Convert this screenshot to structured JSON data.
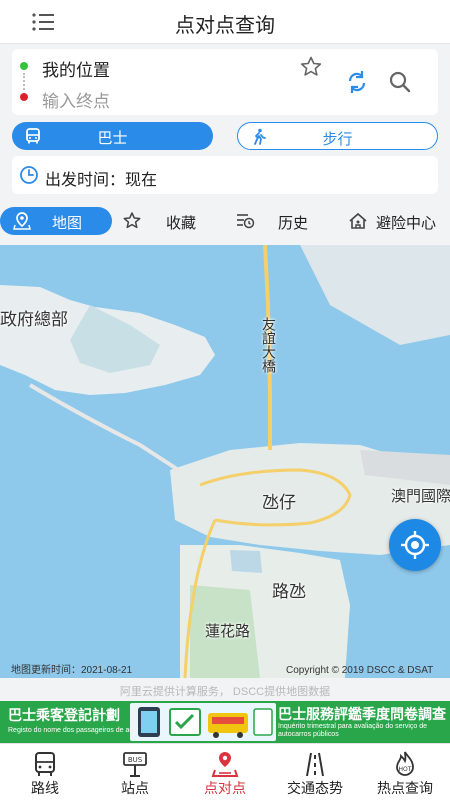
{
  "header": {
    "title": "点对点查询",
    "menu_icon": "menu-icon"
  },
  "route": {
    "from": "我的位置",
    "to_placeholder": "输入终点",
    "start_color": "#33c33c",
    "end_color": "#d9222a"
  },
  "modes": {
    "bus": "巴士",
    "walk": "步行",
    "active": "bus",
    "accent": "#2b8be8"
  },
  "departure": {
    "label": "出发时间：现在"
  },
  "tabs": [
    {
      "label": "地图",
      "icon": "map-pin-icon"
    },
    {
      "label": "收藏",
      "icon": "star-icon"
    },
    {
      "label": "历史",
      "icon": "history-icon"
    },
    {
      "label": "避险中心",
      "icon": "shelter-icon"
    }
  ],
  "map": {
    "labels": [
      "政府總部",
      "友誼大橋",
      "氹仔",
      "澳門國際",
      "路氹",
      "蓮花路"
    ],
    "update_text": "地图更新时间：2021-08-21",
    "copyright": "Copyright © 2019 DSCC & DSAT"
  },
  "credit": "阿里云提供计算服务， DSCC提供地图数据",
  "banner": {
    "left_title": "巴士乘客登記計劃",
    "left_sub": "Registo do nome dos passageiros de autocarros",
    "right_title": "巴士服務評鑑季度問卷調查",
    "right_sub": "Inquérito trimestral para avaliação do serviço de autocarros públicos",
    "color": "#2aa64a"
  },
  "nav": [
    {
      "label": "路线",
      "icon": "bus-route-icon"
    },
    {
      "label": "站点",
      "icon": "bus-stop-icon"
    },
    {
      "label": "点对点",
      "icon": "point-to-point-icon"
    },
    {
      "label": "交通态势",
      "icon": "traffic-icon"
    },
    {
      "label": "热点查询",
      "icon": "hot-icon"
    }
  ],
  "nav_active_color": "#d9343f"
}
